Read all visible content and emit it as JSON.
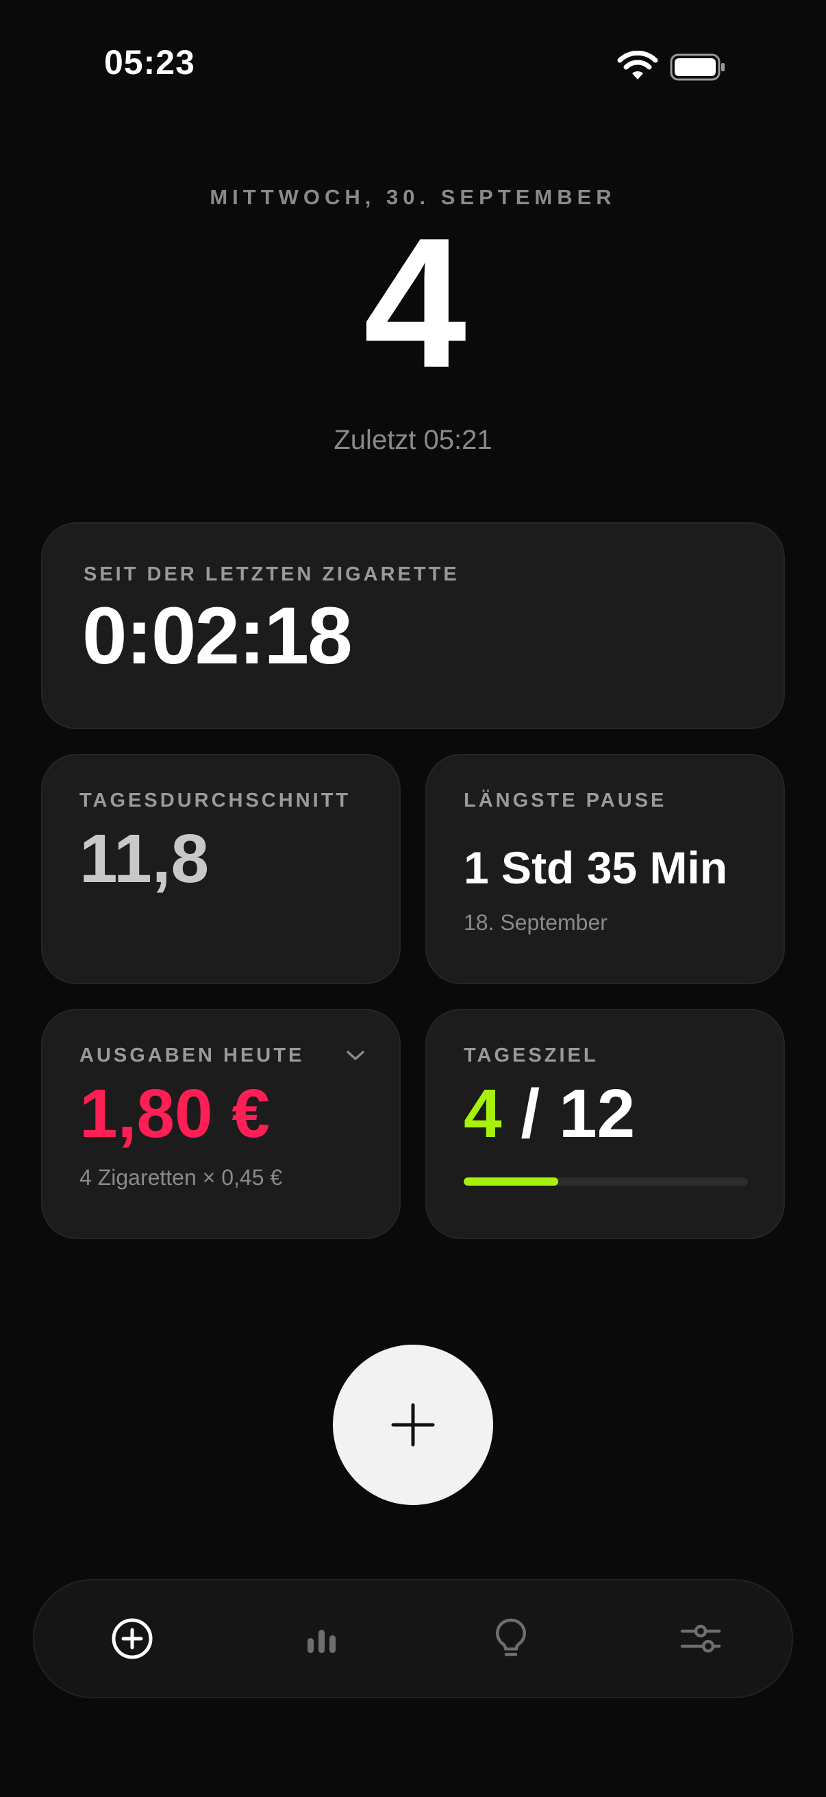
{
  "status_bar": {
    "time": "05:23",
    "icons": [
      "wifi-icon",
      "battery-icon"
    ]
  },
  "header": {
    "date": "MITTWOCH, 30. SEPTEMBER",
    "count": "4",
    "last": "Zuletzt 05:21"
  },
  "since_card": {
    "label": "SEIT DER LETZTEN ZIGARETTE",
    "value": "0:02:18"
  },
  "average_card": {
    "label": "TAGESDURCHSCHNITT",
    "value": "11,8"
  },
  "pause_card": {
    "label": "LÄNGSTE PAUSE",
    "value": "1 Std 35 Min",
    "date": "18. September"
  },
  "spend_card": {
    "label": "AUSGABEN HEUTE",
    "value": "1,80 €",
    "detail": "4 Zigaretten × 0,45 €",
    "color": "#ff1f55"
  },
  "goal_card": {
    "label": "TAGESZIEL",
    "current": "4",
    "separator": "/",
    "total": "12",
    "progress": 0.3333,
    "accent": "#a6f20a"
  },
  "add_button": {
    "icon": "plus-icon"
  },
  "nav": {
    "items": [
      {
        "icon": "add-circle-icon",
        "active": true
      },
      {
        "icon": "bar-chart-icon",
        "active": false
      },
      {
        "icon": "lightbulb-icon",
        "active": false
      },
      {
        "icon": "sliders-icon",
        "active": false
      }
    ]
  }
}
